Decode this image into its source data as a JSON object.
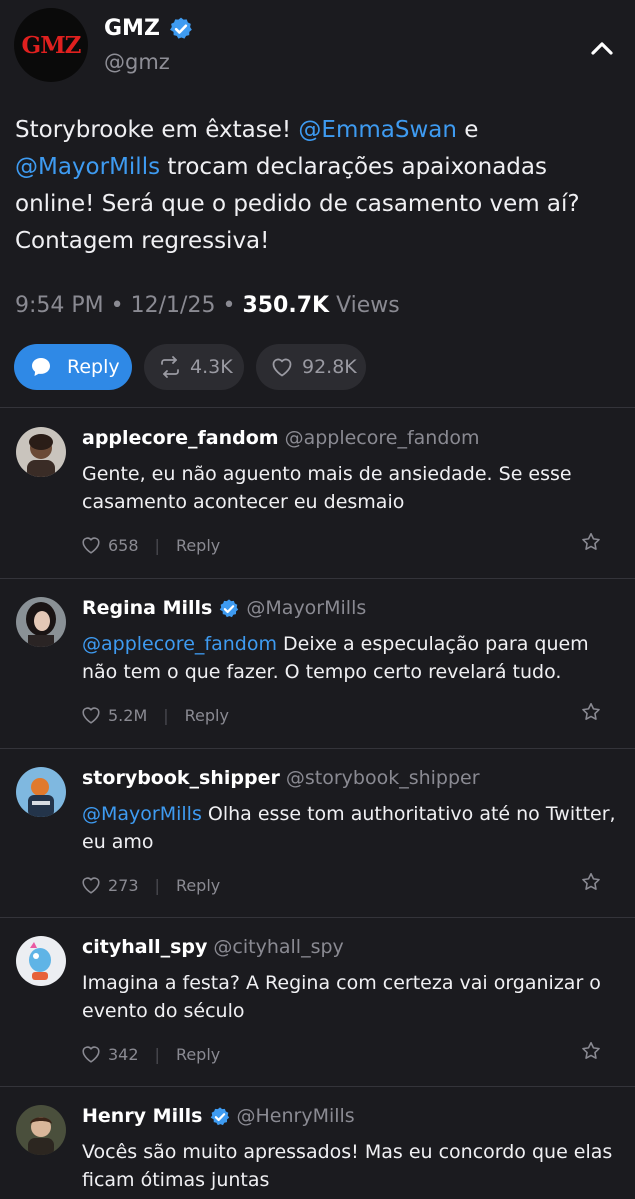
{
  "post": {
    "author_name": "GMZ",
    "author_handle": "@gmz",
    "logo_text": "GMZ",
    "text_before_1": "Storybrooke em êxtase! ",
    "mention_1": "@EmmaSwan",
    "text_between": " e ",
    "mention_2": "@MayorMills",
    "text_after": " trocam declarações apaixonadas online! Será que o pedido de casamento vem aí? Contagem regressiva!",
    "time": "9:54 PM",
    "date": "12/1/25",
    "views_count": "350.7K",
    "views_label": "Views",
    "reply_label": "Reply",
    "retweets": "4.3K",
    "likes": "92.8K"
  },
  "comments": [
    {
      "name": "applecore_fandom",
      "handle": "@applecore_fandom",
      "mention": "",
      "text": "Gente, eu não aguento mais de ansiedade. Se esse casamento acontecer eu desmaio",
      "likes": "658",
      "reply_label": "Reply"
    },
    {
      "name": "Regina Mills",
      "handle": "@MayorMills",
      "mention": "@applecore_fandom",
      "text": " Deixe a especulação para quem não tem o que fazer. O tempo certo revelará tudo.",
      "likes": "5.2M",
      "reply_label": "Reply"
    },
    {
      "name": "storybook_shipper",
      "handle": "@storybook_shipper",
      "mention": "@MayorMills",
      "text": " Olha esse tom authoritativo até no Twitter, eu amo",
      "likes": "273",
      "reply_label": "Reply"
    },
    {
      "name": "cityhall_spy",
      "handle": "@cityhall_spy",
      "mention": "",
      "text": "Imagina a festa? A Regina com certeza vai organizar o evento do século",
      "likes": "342",
      "reply_label": "Reply"
    },
    {
      "name": "Henry Mills",
      "handle": "@HenryMills",
      "mention": "",
      "text": "Vocês são muito apressados! Mas eu concordo que elas ficam ótimas juntas",
      "likes": "",
      "reply_label": ""
    }
  ],
  "colors": {
    "background": "#1b1b1f",
    "accent": "#2f89e6",
    "mention": "#3e9bf1",
    "logo_red": "#e0201f"
  },
  "icons": [
    "verified-badge-icon",
    "chevron-up-icon",
    "chat-bubble-icon",
    "retweet-icon",
    "heart-icon",
    "star-icon"
  ]
}
